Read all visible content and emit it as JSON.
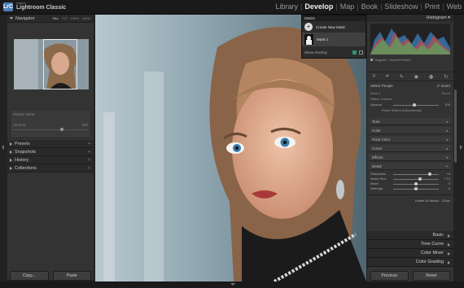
{
  "app": {
    "badge": "LrC",
    "brand_small": "Adobe",
    "name": "Lightroom Classic"
  },
  "modules": [
    "Library",
    "Develop",
    "Map",
    "Book",
    "Slideshow",
    "Print",
    "Web"
  ],
  "active_module": "Develop",
  "left": {
    "navigator": {
      "title": "Navigator",
      "zoom": [
        "FILL",
        "FIT",
        "100%",
        "400%"
      ],
      "active_zoom": "FILL"
    },
    "mask_preset": {
      "label": "Preset: None",
      "amount_label": "Amount",
      "amount_value": "100"
    },
    "panels": [
      "Presets",
      "Snapshots",
      "History",
      "Collections"
    ],
    "copy": "Copy...",
    "paste": "Paste"
  },
  "masks": {
    "title": "Masks",
    "create_new": "Create New Mask",
    "mask_item": "Mask 1",
    "show_overlay": "Show Overlay"
  },
  "right": {
    "histogram": "Histogram",
    "photo_info": "Original + Smart Preview",
    "mask_type": "Select People",
    "invert_label": "Invert",
    "mask_sub": "Mask 1",
    "reset_label": "Reset",
    "effect_label": "Effect: Custom",
    "amount_label": "Amount",
    "amount_value": "100",
    "auto_label": "Reset Sliders Automatically",
    "sections": [
      "Tone",
      "Color",
      "Point Color",
      "Curve",
      "Effects"
    ],
    "detail_title": "Detail",
    "detail_sliders": [
      {
        "label": "Sharpness",
        "value": "+0",
        "pos": 0.82
      },
      {
        "label": "Noise Red.",
        "value": "+ 12",
        "pos": 0.6
      },
      {
        "label": "Moire",
        "value": "0",
        "pos": 0.5
      },
      {
        "label": "Defringe",
        "value": "0",
        "pos": 0.5
      }
    ],
    "delete_all": "Delete All Masks",
    "close": "Close",
    "panels": [
      "Basic",
      "Tone Curve",
      "Color Mixer",
      "Color Grading"
    ],
    "previous": "Previous",
    "reset": "Reset"
  },
  "colors": {
    "badge": "#4d7fb8",
    "bg": "#333333",
    "accent": "#2e9a6a"
  },
  "icons": [
    "crop-icon",
    "heal-icon",
    "redeye-icon",
    "mask-icon",
    "gear-icon"
  ]
}
